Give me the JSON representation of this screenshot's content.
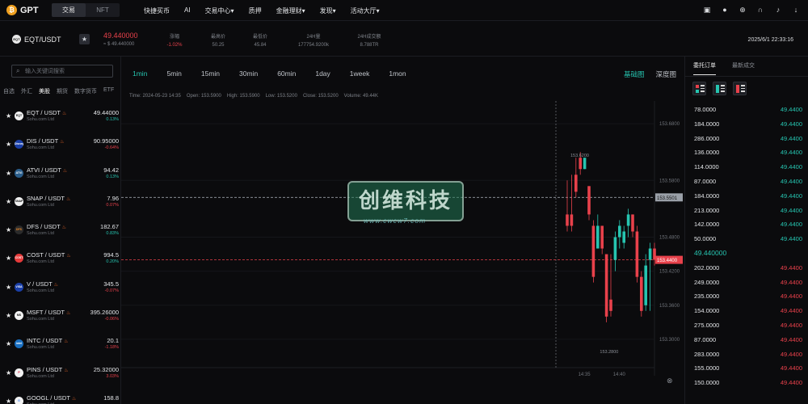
{
  "nav": {
    "logo_letter": "₿",
    "logo_text": "GPT",
    "segments": [
      "交易",
      "NFT"
    ],
    "menu": [
      "快捷买币",
      "AI",
      "交易中心▾",
      "质押",
      "金融理财▾",
      "发现▾",
      "活动大厅▾"
    ],
    "icons": [
      "wallet-icon",
      "user-icon",
      "globe-icon",
      "headset-icon",
      "bell-icon",
      "download-icon"
    ]
  },
  "ticker": {
    "icon_text": "EQT",
    "symbol": "EQT/USDT",
    "price": "49.440000",
    "fiat": "≈ $ 49.440000",
    "stats": [
      {
        "label": "涨幅",
        "value": "-1.02%",
        "red": true
      },
      {
        "label": "最高价",
        "value": "50.25",
        "red": false
      },
      {
        "label": "最低价",
        "value": "45.84",
        "red": false
      },
      {
        "label": "24H量",
        "value": "177754.9200k",
        "red": false
      },
      {
        "label": "24H成交额",
        "value": "8.788TR",
        "red": false
      }
    ],
    "datetime": "2025/6/1 22:33:16"
  },
  "left": {
    "search_placeholder": "输入关键词搜索",
    "categories": [
      "自选",
      "外汇",
      "美股",
      "期货",
      "数字货币",
      "ETF"
    ],
    "active_category": 2,
    "pairs": [
      {
        "symbol": "EQT / USDT",
        "company": "Sohu.com Ltd",
        "price": "49.44000",
        "change": "0.13%",
        "up": true,
        "icon": "EQT",
        "color": "#f2f2f2",
        "fg": "#111"
      },
      {
        "symbol": "DIS / USDT",
        "company": "Sohu.com Ltd",
        "price": "90.95000",
        "change": "-0.64%",
        "up": false,
        "icon": "Disney",
        "color": "#1a3fa8",
        "fg": "#fff"
      },
      {
        "symbol": "ATVI / USDT",
        "company": "Sohu.com Ltd",
        "price": "94.42",
        "change": "0.13%",
        "up": true,
        "icon": "ATVI",
        "color": "#2a5d8a",
        "fg": "#fff"
      },
      {
        "symbol": "SNAP / USDT",
        "company": "Sohu.com Ltd",
        "price": "7.96",
        "change": "0.07%",
        "up": false,
        "icon": "SNAP",
        "color": "#f2f2f2",
        "fg": "#111"
      },
      {
        "symbol": "DFS / USDT",
        "company": "Sohu.com Ltd",
        "price": "182.67",
        "change": "0.83%",
        "up": true,
        "icon": "DFS",
        "color": "#2b2b2b",
        "fg": "#f08a2a"
      },
      {
        "symbol": "COST / USDT",
        "company": "Sohu.com Ltd",
        "price": "994.5",
        "change": "0.20%",
        "up": true,
        "icon": "COST",
        "color": "#e63a3a",
        "fg": "#fff"
      },
      {
        "symbol": "V / USDT",
        "company": "Sohu.com Ltd",
        "price": "345.5",
        "change": "-0.07%",
        "up": false,
        "icon": "VISA",
        "color": "#1a3fa8",
        "fg": "#fff"
      },
      {
        "symbol": "MSFT / USDT",
        "company": "Sohu.com Ltd",
        "price": "395.26000",
        "change": "-0.06%",
        "up": false,
        "icon": "MS",
        "color": "#f2f2f2",
        "fg": "#111"
      },
      {
        "symbol": "INTC / USDT",
        "company": "Sohu.com Ltd",
        "price": "20.1",
        "change": "-1.18%",
        "up": false,
        "icon": "intel",
        "color": "#1a6fc0",
        "fg": "#fff"
      },
      {
        "symbol": "PINS / USDT",
        "company": "Sohu.com Ltd",
        "price": "25.32000",
        "change": "3.03%",
        "up": false,
        "icon": "P",
        "color": "#f2f2f2",
        "fg": "#e0203c"
      },
      {
        "symbol": "GOOGL / USDT",
        "company": "Sohu.com Ltd",
        "price": "158.8",
        "change": "",
        "up": true,
        "icon": "G",
        "color": "#f2f2f2",
        "fg": "#4285f4"
      }
    ]
  },
  "chart_panel": {
    "intervals": [
      "1min",
      "5min",
      "15min",
      "30min",
      "60min",
      "1day",
      "1week",
      "1mon"
    ],
    "active_interval": 0,
    "views": [
      "基础图",
      "深度图"
    ],
    "active_view": 0,
    "ohlc": [
      "Time: 2024-05-23 14:35",
      "Open: 153.5900",
      "High: 153.5900",
      "Low: 153.5200",
      "Close: 153.5200",
      "Volume: 49.44K"
    ],
    "watermark": "创维科技",
    "watermark_sub": "www.cwcw7.com",
    "reset_icon": "⊗"
  },
  "chart_data": {
    "type": "candlestick",
    "ylim": [
      153.25,
      153.72
    ],
    "yticks": [
      153.68,
      153.58,
      153.48,
      153.42,
      153.36,
      153.3
    ],
    "xticks": [
      {
        "label": "14:35",
        "x": 4
      },
      {
        "label": "14:40",
        "x": 12
      }
    ],
    "x_range": [
      0,
      21
    ],
    "hlines": [
      {
        "value": 153.5501,
        "label": "153.5501",
        "color": "#9aa0a8"
      },
      {
        "value": 153.44,
        "label": "153.4400",
        "color": "#e8414b"
      }
    ],
    "annotations": [
      {
        "text": "153.6200",
        "value": 153.62
      },
      {
        "text": "153.2800",
        "value": 153.28
      }
    ],
    "candles": [
      {
        "o": 153.52,
        "h": 153.58,
        "l": 153.49,
        "c": 153.5
      },
      {
        "o": 153.52,
        "h": 153.59,
        "l": 153.49,
        "c": 153.5
      },
      {
        "o": 153.59,
        "h": 153.62,
        "l": 153.55,
        "c": 153.56
      },
      {
        "o": 153.62,
        "h": 153.63,
        "l": 153.59,
        "c": 153.6
      },
      {
        "o": 153.6,
        "h": 153.62,
        "l": 153.6,
        "c": 153.62
      },
      {
        "o": 153.57,
        "h": 153.57,
        "l": 153.51,
        "c": 153.52
      },
      {
        "o": 153.5,
        "h": 153.51,
        "l": 153.4,
        "c": 153.41
      },
      {
        "o": 153.46,
        "h": 153.52,
        "l": 153.46,
        "c": 153.5
      },
      {
        "o": 153.5,
        "h": 153.5,
        "l": 153.45,
        "c": 153.46
      },
      {
        "o": 153.45,
        "h": 153.45,
        "l": 153.33,
        "c": 153.34
      },
      {
        "o": 153.37,
        "h": 153.45,
        "l": 153.34,
        "c": 153.35
      },
      {
        "o": 153.44,
        "h": 153.49,
        "l": 153.42,
        "c": 153.48
      },
      {
        "o": 153.48,
        "h": 153.51,
        "l": 153.46,
        "c": 153.5
      },
      {
        "o": 153.47,
        "h": 153.5,
        "l": 153.46,
        "c": 153.49
      },
      {
        "o": 153.5,
        "h": 153.53,
        "l": 153.48,
        "c": 153.52
      },
      {
        "o": 153.52,
        "h": 153.52,
        "l": 153.48,
        "c": 153.49
      },
      {
        "o": 153.49,
        "h": 153.5,
        "l": 153.4,
        "c": 153.41
      },
      {
        "o": 153.41,
        "h": 153.42,
        "l": 153.34,
        "c": 153.35
      },
      {
        "o": 153.36,
        "h": 153.45,
        "l": 153.35,
        "c": 153.43
      },
      {
        "o": 153.44,
        "h": 153.47,
        "l": 153.35,
        "c": 153.46
      },
      {
        "o": 153.46,
        "h": 153.47,
        "l": 153.43,
        "c": 153.44
      }
    ],
    "up_color": "#26c4b0",
    "down_color": "#e8414b"
  },
  "orderbook": {
    "tabs": [
      "委托订单",
      "最新成交"
    ],
    "active_tab": 0,
    "asks": [
      {
        "price": "78.0000",
        "qty": "49.4400"
      },
      {
        "price": "184.0000",
        "qty": "49.4400"
      },
      {
        "price": "286.0000",
        "qty": "49.4400"
      },
      {
        "price": "136.0000",
        "qty": "49.4400"
      },
      {
        "price": "114.0000",
        "qty": "49.4400"
      },
      {
        "price": "87.0000",
        "qty": "49.4400"
      },
      {
        "price": "184.0000",
        "qty": "49.4400"
      },
      {
        "price": "213.0000",
        "qty": "49.4400"
      },
      {
        "price": "142.0000",
        "qty": "49.4400"
      },
      {
        "price": "50.0000",
        "qty": "49.4400"
      }
    ],
    "mid": "49.440000",
    "bids": [
      {
        "price": "202.0000",
        "qty": "49.4400"
      },
      {
        "price": "249.0000",
        "qty": "49.4400"
      },
      {
        "price": "235.0000",
        "qty": "49.4400"
      },
      {
        "price": "154.0000",
        "qty": "49.4400"
      },
      {
        "price": "275.0000",
        "qty": "49.4400"
      },
      {
        "price": "87.0000",
        "qty": "49.4400"
      },
      {
        "price": "283.0000",
        "qty": "49.4400"
      },
      {
        "price": "155.0000",
        "qty": "49.4400"
      },
      {
        "price": "150.0000",
        "qty": "49.4400"
      }
    ],
    "ask_color": "#26c4b0",
    "bid_color": "#e8414b"
  }
}
